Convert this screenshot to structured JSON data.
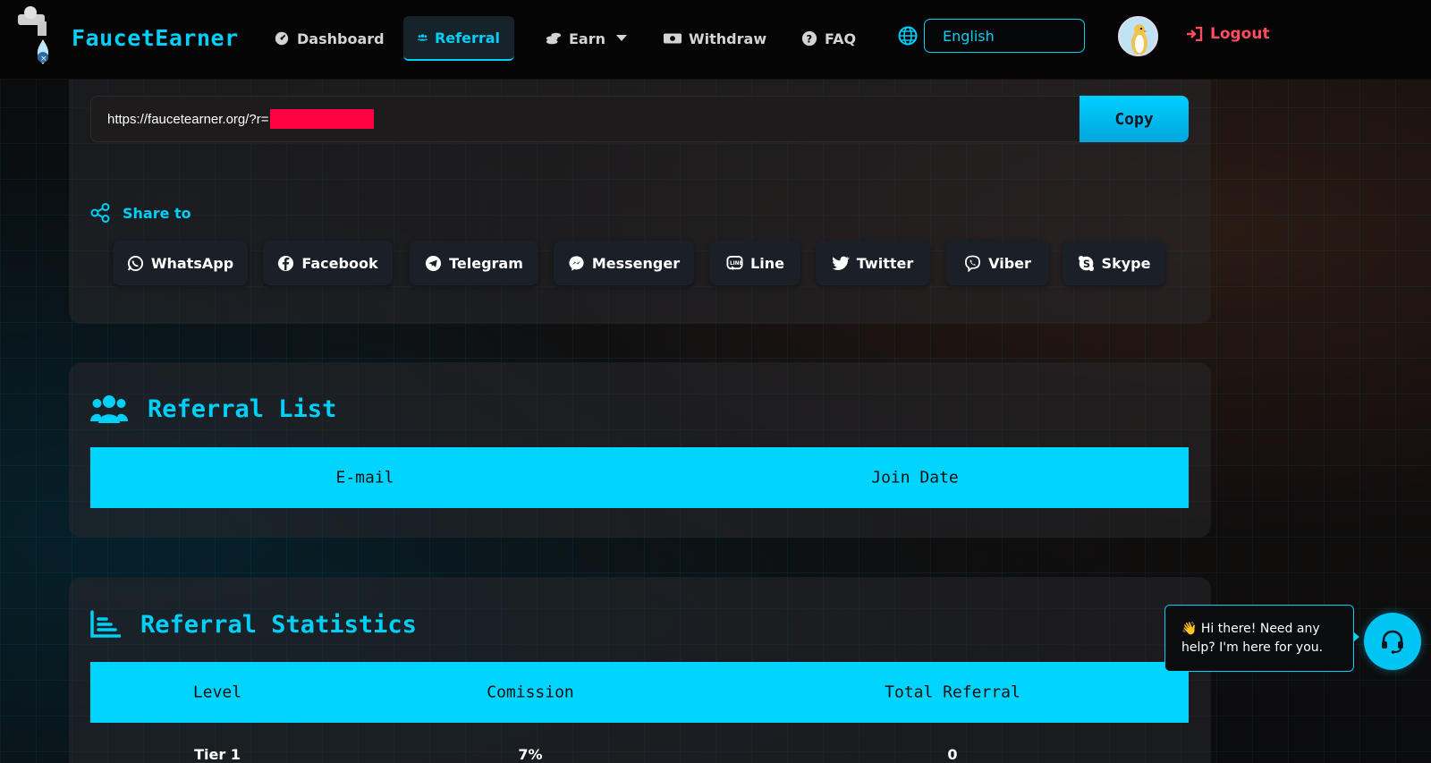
{
  "brand": {
    "name": "FaucetEarner"
  },
  "nav": {
    "dashboard": "Dashboard",
    "referral": "Referral",
    "earn": "Earn",
    "withdraw": "Withdraw",
    "faq": "FAQ",
    "language": "English",
    "logout": "Logout"
  },
  "referral_link": {
    "url_prefix": "https://faucetearner.org/?r=",
    "copy_label": "Copy"
  },
  "share": {
    "label": "Share to",
    "buttons": [
      "WhatsApp",
      "Facebook",
      "Telegram",
      "Messenger",
      "Line",
      "Twitter",
      "Viber",
      "Skype"
    ]
  },
  "referral_list": {
    "title": "Referral List",
    "columns": [
      "E-mail",
      "Join Date"
    ]
  },
  "referral_stats": {
    "title": "Referral Statistics",
    "columns": [
      "Level",
      "Comission",
      "Total Referral"
    ],
    "rows": [
      {
        "level": "Tier 1",
        "commission": "7%",
        "total": "0"
      }
    ]
  },
  "chat": {
    "message": "👋 Hi there! Need any help? I'm here for you."
  },
  "colors": {
    "accent": "#00cff7",
    "logout": "#ff4d5e",
    "redaction": "#ff0040"
  }
}
